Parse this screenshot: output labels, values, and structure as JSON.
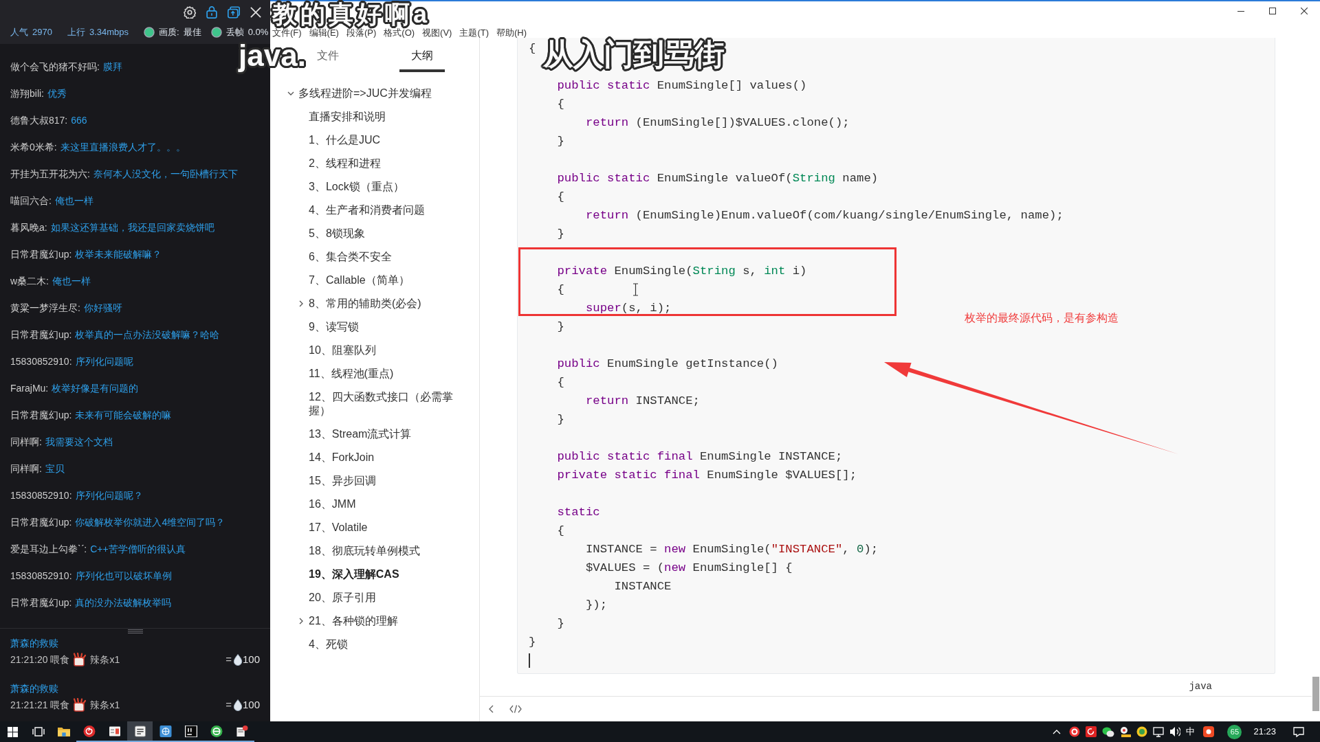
{
  "stream_panel": {
    "stats": [
      {
        "kind": "plain",
        "label": "人气",
        "value": "2970"
      },
      {
        "kind": "plain",
        "label": "上行",
        "value": "3.34mbps"
      },
      {
        "kind": "indicator",
        "label": "画质:",
        "value": "最佳"
      },
      {
        "kind": "indicator",
        "label": "丢帧",
        "value": "0.0%"
      }
    ],
    "messages": [
      {
        "user": "做个会飞的猪不好吗:",
        "text": "膜拜"
      },
      {
        "user": "游翔bili:",
        "text": "优秀"
      },
      {
        "user": "德鲁大叔817:",
        "text": "666"
      },
      {
        "user": "米希0米希:",
        "text": "来这里直播浪费人才了。。。"
      },
      {
        "user": "开挂为五开花为六:",
        "text": "奈何本人没文化，一句卧槽行天下"
      },
      {
        "user": "喵回六合:",
        "text": "俺也一样"
      },
      {
        "user": "暮风晚a:",
        "text": "如果这还算基础，我还是回家卖烧饼吧"
      },
      {
        "user": "日常君魔幻up:",
        "text": "枚举未来能破解嘛？"
      },
      {
        "user": "w桑二木:",
        "text": "俺也一样"
      },
      {
        "user": "黄粱一梦浮生尽:",
        "text": "你好骚呀"
      },
      {
        "user": "日常君魔幻up:",
        "text": "枚举真的一点办法没破解嘛？哈哈"
      },
      {
        "user": "15830852910:",
        "text": "序列化问题呢"
      },
      {
        "user": "FarajMu:",
        "text": "枚举好像是有问题的"
      },
      {
        "user": "日常君魔幻up:",
        "text": "未来有可能会破解的嘛"
      },
      {
        "user": "同样啊:",
        "text": "我需要这个文档"
      },
      {
        "user": "同样啊:",
        "text": "宝贝"
      },
      {
        "user": "15830852910:",
        "text": "序列化问题呢？"
      },
      {
        "user": "日常君魔幻up:",
        "text": "你破解枚举你就进入4维空间了吗？"
      },
      {
        "user": "爱是耳边上勾拳ˋˊ:",
        "text": "C++苦学僧听的很认真"
      },
      {
        "user": "15830852910:",
        "text": "序列化也可以破坏单例"
      },
      {
        "user": "日常君魔幻up:",
        "text": "真的没办法破解枚举吗"
      }
    ],
    "gifts": [
      {
        "user": "萧森的救赎",
        "meta": "21:21:20 喂食",
        "item": "辣条x1",
        "equals": "=",
        "amount": "100"
      },
      {
        "user": "萧森的救赎",
        "meta": "21:21:21 喂食",
        "item": "辣条x1",
        "equals": "=",
        "amount": "100"
      }
    ]
  },
  "danmaku": [
    {
      "text": "教的真好啊a"
    },
    {
      "text": "java."
    },
    {
      "text": "从入门到骂街"
    }
  ],
  "editor_window": {
    "menu": [
      "文件(F)",
      "编辑(E)",
      "段落(P)",
      "格式(O)",
      "视图(V)",
      "主题(T)",
      "帮助(H)"
    ],
    "sidebar": {
      "tabs": [
        {
          "label": "文件",
          "selected": false
        },
        {
          "label": "大纲",
          "selected": true
        }
      ],
      "outline": [
        {
          "title": "多线程进阶=>JUC并发编程",
          "selected": false,
          "expanded": true,
          "children": [
            {
              "title": "直播安排和说明",
              "selected": false
            },
            {
              "title": "1、什么是JUC",
              "selected": false
            },
            {
              "title": "2、线程和进程",
              "selected": false
            },
            {
              "title": "3、Lock锁（重点）",
              "selected": false
            },
            {
              "title": "4、生产者和消费者问题",
              "selected": false
            },
            {
              "title": "5、8锁现象",
              "selected": false
            },
            {
              "title": "6、集合类不安全",
              "selected": false
            },
            {
              "title": "7、Callable（简单）",
              "selected": false
            },
            {
              "title": "8、常用的辅助类(必会)",
              "selected": false,
              "expanded": false
            },
            {
              "title": "9、读写锁",
              "selected": false
            },
            {
              "title": "10、阻塞队列",
              "selected": false
            },
            {
              "title": "11、线程池(重点)",
              "selected": false
            },
            {
              "title": "12、四大函数式接口（必需掌握）",
              "selected": false
            },
            {
              "title": "13、Stream流式计算",
              "selected": false
            },
            {
              "title": "14、ForkJoin",
              "selected": false
            },
            {
              "title": "15、异步回调",
              "selected": false
            },
            {
              "title": "16、JMM",
              "selected": false
            },
            {
              "title": "17、Volatile",
              "selected": false
            },
            {
              "title": "18、彻底玩转单例模式",
              "selected": false
            },
            {
              "title": "19、深入理解CAS",
              "selected": true
            },
            {
              "title": "20、原子引用",
              "selected": false
            },
            {
              "title": "21、各种锁的理解",
              "selected": false,
              "expanded": false
            },
            {
              "title": "4、死锁",
              "selected": false
            }
          ]
        }
      ]
    },
    "code_block": {
      "language": "java",
      "blocks": [
        [
          [
            {
              "text": "{",
              "kind": "plain"
            }
          ]
        ],
        [
          [
            {
              "text": "    public",
              "kind": "keyword"
            },
            {
              "text": " static",
              "kind": "keyword"
            },
            {
              "text": " EnumSingle[] values()",
              "kind": "plain"
            }
          ],
          [
            {
              "text": "    {",
              "kind": "plain"
            }
          ],
          [
            {
              "text": "        return",
              "kind": "keyword"
            },
            {
              "text": " (EnumSingle[])$VALUES.clone();",
              "kind": "plain"
            }
          ],
          [
            {
              "text": "    }",
              "kind": "plain"
            }
          ]
        ],
        [
          [
            {
              "text": "    public",
              "kind": "keyword"
            },
            {
              "text": " static",
              "kind": "keyword"
            },
            {
              "text": " EnumSingle valueOf(",
              "kind": "plain"
            },
            {
              "text": "String",
              "kind": "type"
            },
            {
              "text": " name)",
              "kind": "plain"
            }
          ],
          [
            {
              "text": "    {",
              "kind": "plain"
            }
          ],
          [
            {
              "text": "        return",
              "kind": "keyword"
            },
            {
              "text": " (EnumSingle)Enum.valueOf(com/kuang/single/EnumSingle, name);",
              "kind": "plain"
            }
          ],
          [
            {
              "text": "    }",
              "kind": "plain"
            }
          ]
        ],
        [
          [
            {
              "text": "    private",
              "kind": "keyword"
            },
            {
              "text": " EnumSingle(",
              "kind": "plain"
            },
            {
              "text": "String",
              "kind": "type"
            },
            {
              "text": " s, ",
              "kind": "plain"
            },
            {
              "text": "int",
              "kind": "type"
            },
            {
              "text": " i)",
              "kind": "plain"
            }
          ],
          [
            {
              "text": "    {",
              "kind": "plain"
            }
          ],
          [
            {
              "text": "        super",
              "kind": "keyword"
            },
            {
              "text": "(s, i);",
              "kind": "plain"
            }
          ],
          [
            {
              "text": "    }",
              "kind": "plain"
            }
          ]
        ],
        [
          [
            {
              "text": "    public",
              "kind": "keyword"
            },
            {
              "text": " EnumSingle getInstance()",
              "kind": "plain"
            }
          ],
          [
            {
              "text": "    {",
              "kind": "plain"
            }
          ],
          [
            {
              "text": "        return",
              "kind": "keyword"
            },
            {
              "text": " INSTANCE;",
              "kind": "plain"
            }
          ],
          [
            {
              "text": "    }",
              "kind": "plain"
            }
          ]
        ],
        [
          [
            {
              "text": "    public",
              "kind": "keyword"
            },
            {
              "text": " static",
              "kind": "keyword"
            },
            {
              "text": " final",
              "kind": "keyword"
            },
            {
              "text": " EnumSingle INSTANCE;",
              "kind": "plain"
            }
          ],
          [
            {
              "text": "    private",
              "kind": "keyword"
            },
            {
              "text": " static",
              "kind": "keyword"
            },
            {
              "text": " final",
              "kind": "keyword"
            },
            {
              "text": " EnumSingle $VALUES[];",
              "kind": "plain"
            }
          ]
        ],
        [
          [
            {
              "text": "    static",
              "kind": "keyword"
            }
          ],
          [
            {
              "text": "    {",
              "kind": "plain"
            }
          ],
          [
            {
              "text": "        INSTANCE = ",
              "kind": "plain"
            },
            {
              "text": "new",
              "kind": "keyword"
            },
            {
              "text": " EnumSingle(",
              "kind": "plain"
            },
            {
              "text": "\"INSTANCE\"",
              "kind": "string"
            },
            {
              "text": ", ",
              "kind": "plain"
            },
            {
              "text": "0",
              "kind": "number"
            },
            {
              "text": ");",
              "kind": "plain"
            }
          ],
          [
            {
              "text": "        $VALUES = (",
              "kind": "plain"
            },
            {
              "text": "new",
              "kind": "keyword"
            },
            {
              "text": " EnumSingle[] {",
              "kind": "plain"
            }
          ],
          [
            {
              "text": "            INSTANCE",
              "kind": "plain"
            }
          ],
          [
            {
              "text": "        });",
              "kind": "plain"
            }
          ],
          [
            {
              "text": "    }",
              "kind": "plain"
            }
          ],
          [
            {
              "text": "}",
              "kind": "plain"
            }
          ]
        ]
      ]
    },
    "annotation": {
      "text": "枚举的最终源代码，是有参构造"
    }
  },
  "taskbar": {
    "apps": [
      {
        "selected": false,
        "running": false
      },
      {
        "selected": false,
        "running": true
      },
      {
        "selected": false,
        "running": true
      },
      {
        "selected": true,
        "running": true
      },
      {
        "selected": false,
        "running": true
      },
      {
        "selected": false,
        "running": true
      },
      {
        "selected": false,
        "running": true
      },
      {
        "selected": false,
        "running": true
      }
    ],
    "tray": {
      "input_method": "中",
      "badge": "65",
      "time": "21:23"
    }
  }
}
